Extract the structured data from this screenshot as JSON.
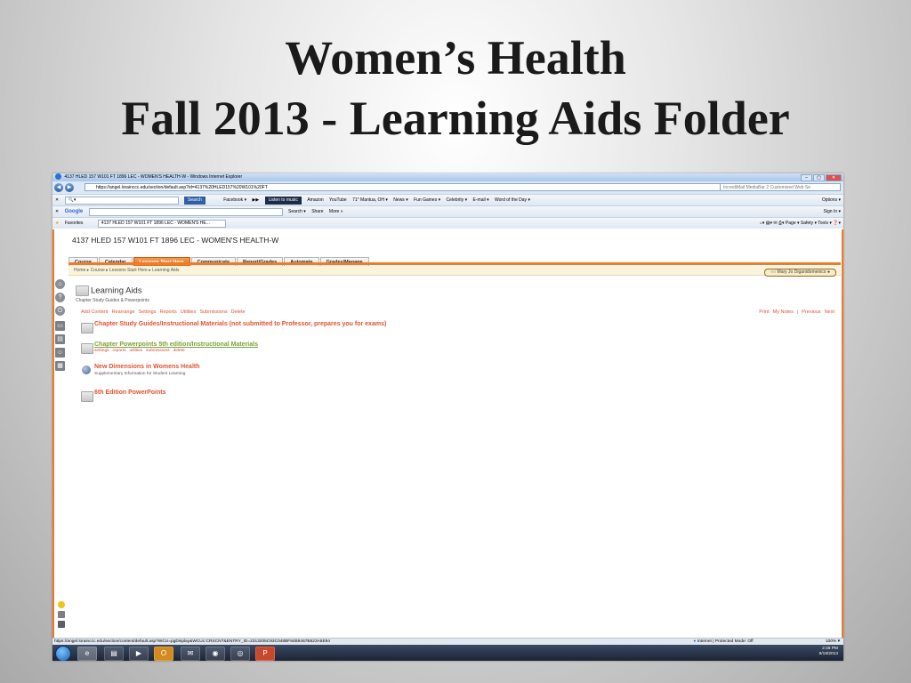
{
  "slide": {
    "title_line1": "Women’s Health",
    "title_line2": "Fall 2013  - Learning Aids Folder"
  },
  "window": {
    "title": "4137 HLED 157 W101 FT 1896 LEC - WOMEN'S HEALTH-W - Windows Internet Explorer",
    "controls": [
      "–",
      "▢",
      "✕"
    ]
  },
  "address_bar": {
    "url": "https://angel.lorainccc.edu/section/default.asp?id=4137%20HLED157%20W101%20FT",
    "search_placeholder": "IncrediMail MediaBar 2 Customized Web Se"
  },
  "toolbar1": {
    "items": [
      "Search",
      "Facebook ▾",
      "Listen to music",
      "Amazon",
      "YouTube",
      "71° Mantua, OH ▾",
      "News ▾",
      "Fun Games ▾",
      "Celebrity ▾",
      "E-mail ▾",
      "Word of the Day ▾"
    ],
    "options": "Options ▾"
  },
  "toolbar2": {
    "brand": "Google",
    "items": [
      "Search ▾",
      "Share",
      "More »"
    ],
    "signin": "Sign In ▾"
  },
  "favorites_bar": {
    "favorites": "Favorites",
    "tab": "4137 HLED 157 W101 FT 1896 LEC - WOMEN'S HE...",
    "commands": [
      "Page ▾",
      "Safety ▾",
      "Tools ▾",
      "❓▾"
    ]
  },
  "page": {
    "course_title": "4137 HLED 157 W101 FT 1896 LEC - WOMEN'S HEALTH-W",
    "tabs": [
      "Course",
      "Calendar",
      "Lessons Start Here",
      "Communicate",
      "Report/Grades",
      "Automate",
      "Grades/Manage"
    ],
    "breadcrumb": "Home  ▸  Course  ▸  Lessons Start Here  ▸  Learning Aids",
    "user": "Mary Jo Diganidomenico",
    "folder_title": "Learning Aids",
    "folder_subtitle": "Chapter Study Guides & Powerpoints",
    "actions": [
      "Add Content",
      "Rearrange",
      "Settings",
      "Reports",
      "Utilities",
      "Submissions",
      "Delete"
    ],
    "right_links": [
      "Print",
      "My Notes",
      "|",
      "Previous",
      "Next"
    ],
    "items": [
      {
        "title": "Chapter Study Guides/Instructional Materials (not submitted to Professor, prepares you for exams)",
        "subtitle": ""
      },
      {
        "title": "Chapter Powerpoints 5th edition/Instructional Materials",
        "links": [
          "settings",
          "reports",
          "utilities",
          "submissions",
          "delete"
        ]
      },
      {
        "title": "New Dimensions in Womens Health",
        "subtitle": "Supplementary Information for Student Learning"
      },
      {
        "title": "6th Edition PowerPoints",
        "subtitle": ""
      }
    ]
  },
  "statusbar": {
    "url": "https://angel.lorainccc.edu/section/content/default.asp?WCU=pgDisplay&WCUc:CRSCNT&ENTRY_ID=2313205C93C048BF84B8467B623A5E94",
    "zone": "Internet | Protected Mode: Off",
    "zoom": "100% ▾"
  },
  "taskbar": {
    "time": "2:48 PM",
    "date": "9/19/2013"
  },
  "colors": {
    "accent_orange": "#f27a24",
    "link_red": "#e2522f",
    "link_green": "#7aa33a"
  }
}
